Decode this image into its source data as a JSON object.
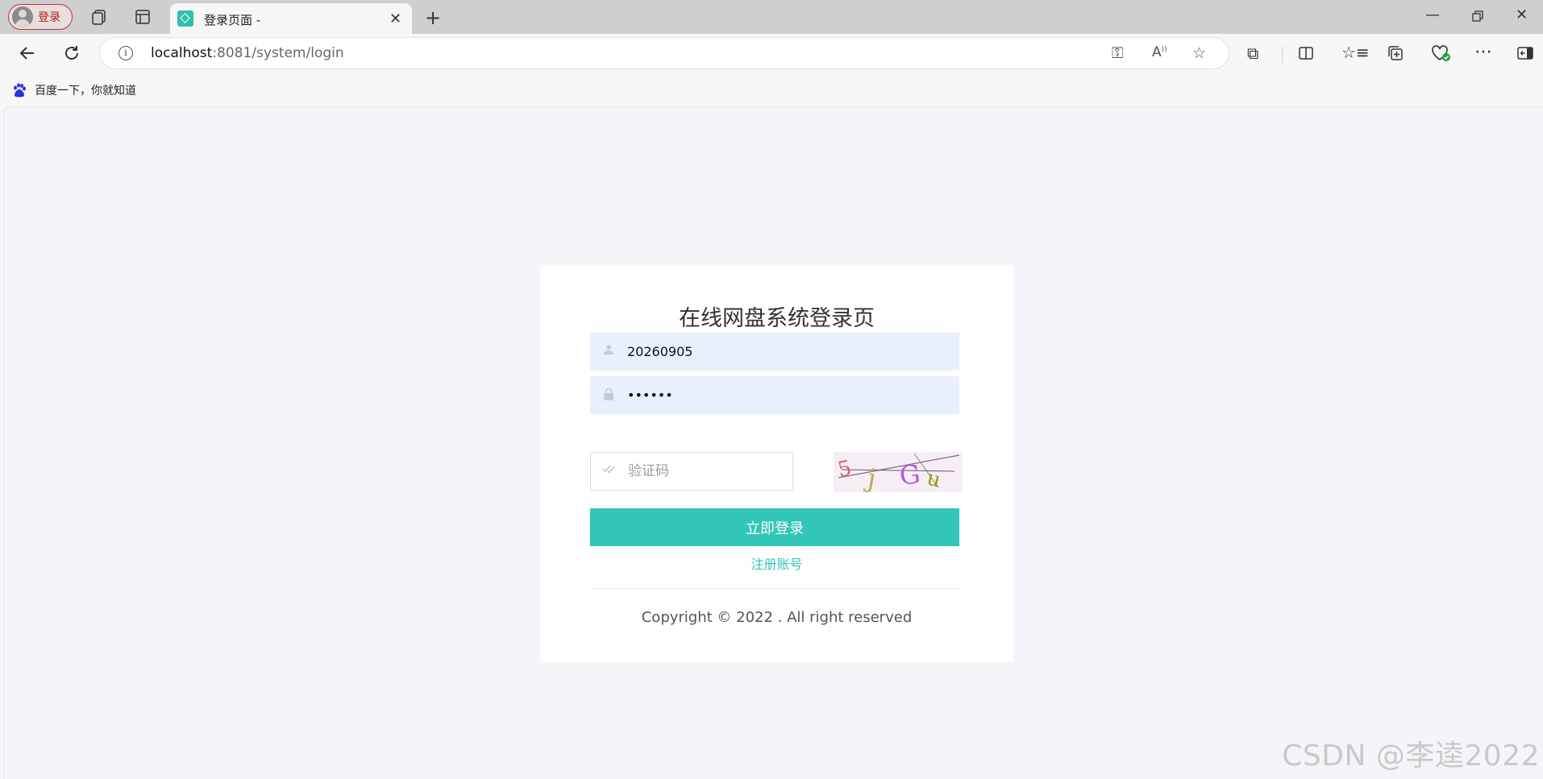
{
  "browser": {
    "profile_label": "登录",
    "tab_title": "登录页面 -",
    "url_host": "localhost",
    "url_path": ":8081/system/login",
    "bookmark_label": "百度一下，你就知道"
  },
  "login": {
    "title": "在线网盘系统登录页",
    "username_value": "20260905",
    "password_value": "••••••",
    "captcha_placeholder": "验证码",
    "captcha_text": "5jGu",
    "submit_label": "立即登录",
    "register_label": "注册账号",
    "copyright": "Copyright © 2022 . All right reserved"
  },
  "watermark": "CSDN @李逵2022",
  "colors": {
    "accent": "#31c6b8",
    "field_bg": "#e8f0fe",
    "page_bg": "#f4f5f8"
  }
}
